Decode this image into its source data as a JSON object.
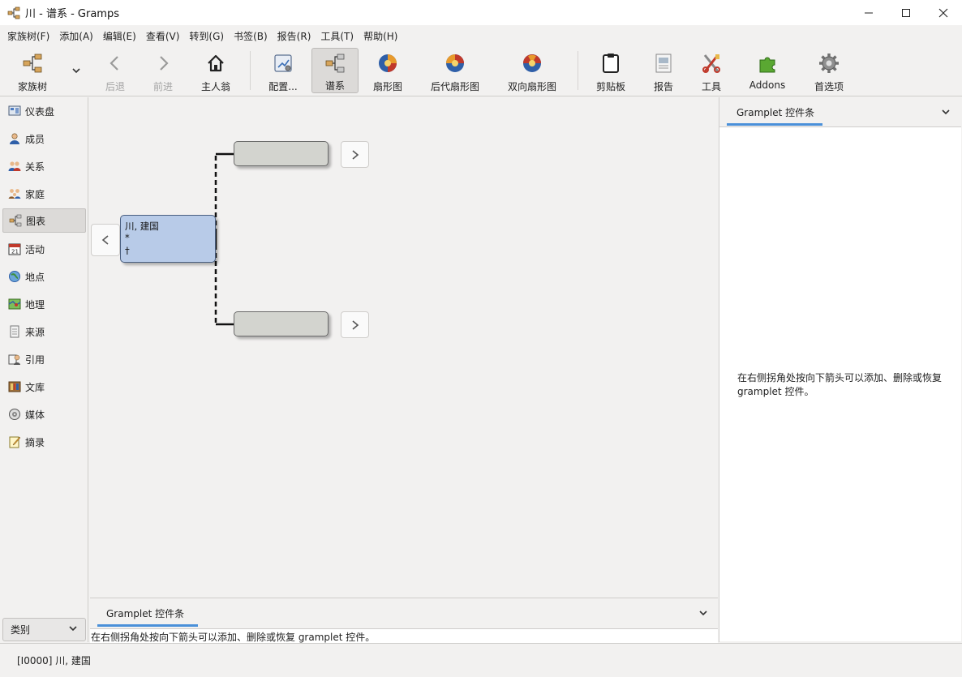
{
  "window": {
    "title": "川 - 谱系 - Gramps",
    "minimize_icon": "minimize-icon",
    "maximize_icon": "maximize-icon",
    "close_icon": "close-icon"
  },
  "menu": [
    "家族树(F)",
    "添加(A)",
    "编辑(E)",
    "查看(V)",
    "转到(G)",
    "书签(B)",
    "报告(R)",
    "工具(T)",
    "帮助(H)"
  ],
  "toolbar": {
    "family_trees": "家族树",
    "back": "后退",
    "forward": "前进",
    "home": "主人翁",
    "configure": "配置...",
    "pedigree": "谱系",
    "fan_chart": "扇形图",
    "desc_fan": "后代扇形图",
    "twoway_fan": "双向扇形图",
    "clipboard": "剪贴板",
    "reports": "报告",
    "tools": "工具",
    "addons": "Addons",
    "preferences": "首选项"
  },
  "sidebar": {
    "items": [
      {
        "label": "仪表盘",
        "icon": "dashboard-icon"
      },
      {
        "label": "成员",
        "icon": "person-icon"
      },
      {
        "label": "关系",
        "icon": "relationships-icon"
      },
      {
        "label": "家庭",
        "icon": "family-icon"
      },
      {
        "label": "图表",
        "icon": "charts-icon",
        "active": true
      },
      {
        "label": "活动",
        "icon": "events-icon"
      },
      {
        "label": "地点",
        "icon": "places-icon"
      },
      {
        "label": "地理",
        "icon": "geography-icon"
      },
      {
        "label": "来源",
        "icon": "sources-icon"
      },
      {
        "label": "引用",
        "icon": "citations-icon"
      },
      {
        "label": "文库",
        "icon": "repositories-icon"
      },
      {
        "label": "媒体",
        "icon": "media-icon"
      },
      {
        "label": "摘录",
        "icon": "notes-icon"
      }
    ],
    "category_label": "类别"
  },
  "chart": {
    "person": {
      "name": "川, 建国",
      "birth": "*",
      "death": "†"
    }
  },
  "bottom_gramplet": {
    "tab": "Gramplet 控件条",
    "message": "在右侧拐角处按向下箭头可以添加、删除或恢复 gramplet 控件。"
  },
  "right_gramplet": {
    "tab": "Gramplet 控件条",
    "message_line1": "在右侧拐角处按向下箭头可以添加、删除或恢复",
    "message_line2": "gramplet 控件。"
  },
  "status": {
    "text": "[I0000] 川, 建国"
  },
  "colors": {
    "main_person_fill": "#b8cbe8",
    "empty_person_fill": "#d3d4cf",
    "accent": "#4a90d9"
  }
}
